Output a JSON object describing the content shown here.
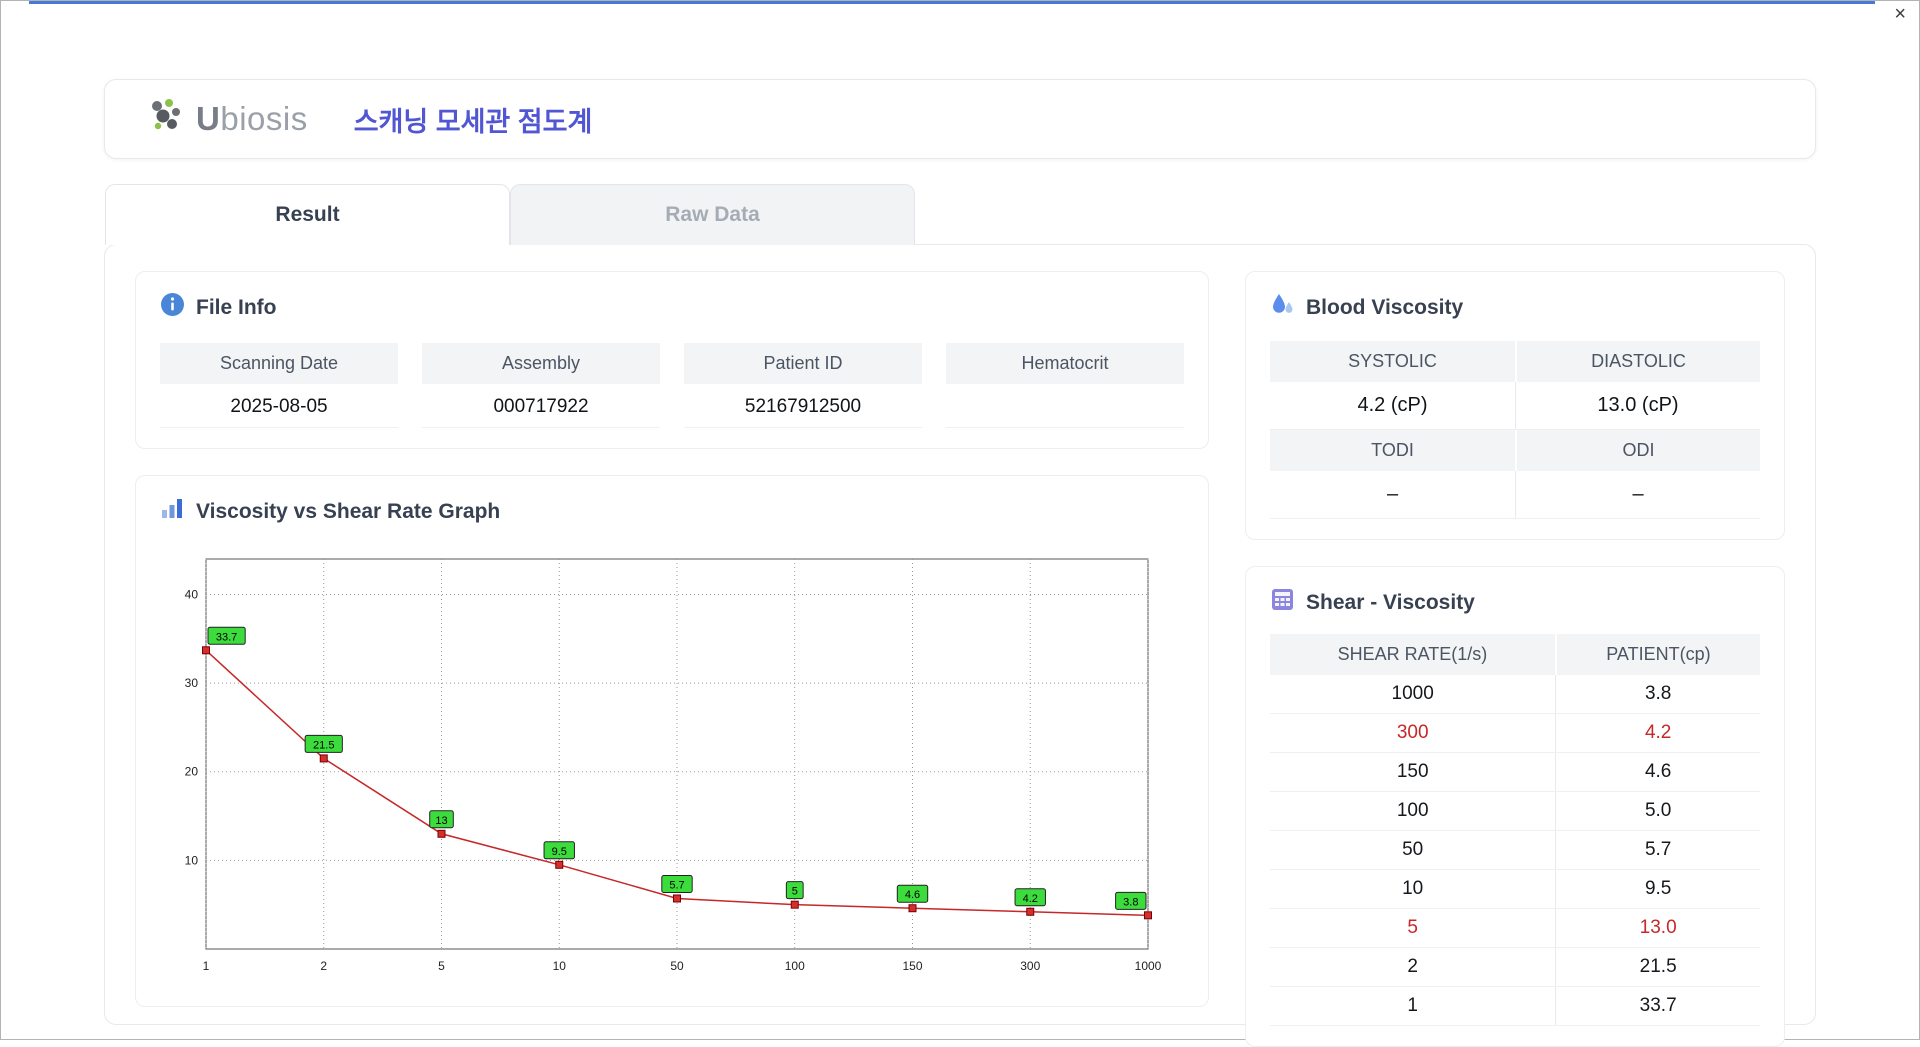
{
  "window": {
    "close_label": "×"
  },
  "header": {
    "brand_bold": "U",
    "brand_rest": "biosis",
    "app_title": "스캐닝 모세관 점도계"
  },
  "tabs": {
    "result": "Result",
    "raw_data": "Raw Data"
  },
  "file_info": {
    "title": "File Info",
    "fields": [
      {
        "label": "Scanning Date",
        "value": "2025-08-05"
      },
      {
        "label": "Assembly",
        "value": "000717922"
      },
      {
        "label": "Patient ID",
        "value": "52167912500"
      },
      {
        "label": "Hematocrit",
        "value": ""
      }
    ]
  },
  "blood_viscosity": {
    "title": "Blood Viscosity",
    "metrics": [
      {
        "label": "SYSTOLIC",
        "value": "4.2 (cP)"
      },
      {
        "label": "DIASTOLIC",
        "value": "13.0 (cP)"
      },
      {
        "label": "TODI",
        "value": "–"
      },
      {
        "label": "ODI",
        "value": "–"
      }
    ]
  },
  "graph": {
    "title": "Viscosity vs Shear Rate Graph"
  },
  "chart_data": {
    "type": "line",
    "title": "Viscosity vs Shear Rate Graph",
    "x": [
      1,
      2,
      5,
      10,
      50,
      100,
      150,
      300,
      1000
    ],
    "y": [
      33.7,
      21.5,
      13,
      9.5,
      5.7,
      5,
      4.6,
      4.2,
      3.8
    ],
    "point_labels": [
      "33.7",
      "21.5",
      "13",
      "9.5",
      "5.7",
      "5",
      "4.6",
      "4.2",
      "3.8"
    ],
    "x_axis_type": "category",
    "xlabel": "",
    "ylabel": "",
    "yticks": [
      10,
      20,
      30,
      40
    ],
    "ylim": [
      0,
      44
    ],
    "grid": true,
    "legend": false,
    "line_color": "#c62828",
    "marker_color": "#d32f2f",
    "label_bg": "#3ddc3d"
  },
  "shear_viscosity": {
    "title": "Shear - Viscosity",
    "headers": [
      "SHEAR RATE(1/s)",
      "PATIENT(cp)"
    ],
    "highlight_color": "#c62828",
    "rows": [
      {
        "rate": "1000",
        "patient": "3.8",
        "highlight": false
      },
      {
        "rate": "300",
        "patient": "4.2",
        "highlight": true
      },
      {
        "rate": "150",
        "patient": "4.6",
        "highlight": false
      },
      {
        "rate": "100",
        "patient": "5.0",
        "highlight": false
      },
      {
        "rate": "50",
        "patient": "5.7",
        "highlight": false
      },
      {
        "rate": "10",
        "patient": "9.5",
        "highlight": false
      },
      {
        "rate": "5",
        "patient": "13.0",
        "highlight": true
      },
      {
        "rate": "2",
        "patient": "21.5",
        "highlight": false
      },
      {
        "rate": "1",
        "patient": "33.7",
        "highlight": false
      }
    ]
  }
}
